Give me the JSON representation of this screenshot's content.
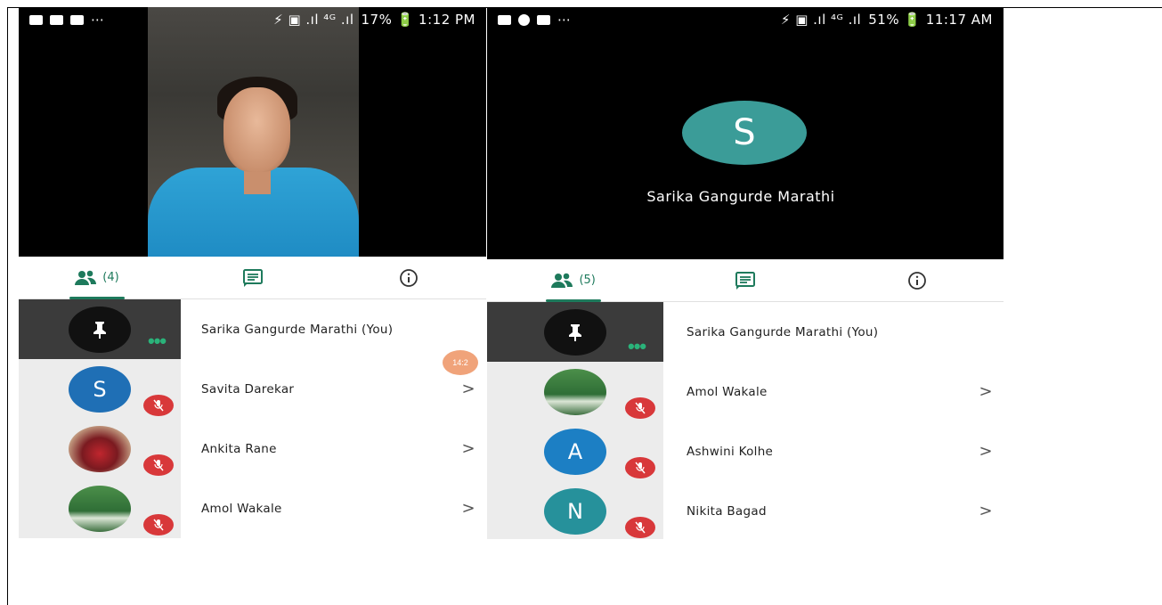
{
  "phone1": {
    "status": {
      "time_text": "17% 🔋 1:12 PM",
      "signal_text": "⚡ ▣ .ıl ⁴ᴳ .ıl",
      "left_icons": "⋯"
    },
    "tabs": {
      "people_count": "(4)"
    },
    "participants": [
      {
        "name": "Sarika Gangurde Marathi (You)",
        "avatar": "pin",
        "badge": "dots",
        "chevron": ""
      },
      {
        "name": "Savita Darekar",
        "avatar": "S",
        "badge": "muted",
        "chevron": ">"
      },
      {
        "name": "Ankita Rane",
        "avatar": "",
        "badge": "muted",
        "chevron": ">"
      },
      {
        "name": "Amol Wakale",
        "avatar": "",
        "badge": "muted",
        "chevron": ">"
      }
    ],
    "floating_bubble": "14:2"
  },
  "phone2": {
    "status": {
      "time_text": "51% 🔋 11:17 AM",
      "signal_text": "⚡ ▣ .ıl ⁴ᴳ .ıl",
      "left_icons": "⋯"
    },
    "caller": {
      "initial": "S",
      "name": "Sarika Gangurde Marathi"
    },
    "tabs": {
      "people_count": "(5)"
    },
    "participants": [
      {
        "name": "Sarika Gangurde Marathi (You)",
        "avatar": "pin",
        "badge": "dots",
        "chevron": ""
      },
      {
        "name": "Amol Wakale",
        "avatar": "",
        "badge": "muted",
        "chevron": ">"
      },
      {
        "name": "Ashwini Kolhe",
        "avatar": "A",
        "badge": "muted",
        "chevron": ">"
      },
      {
        "name": "Nikita Bagad",
        "avatar": "N",
        "badge": "muted",
        "chevron": ">"
      }
    ]
  },
  "colors": {
    "accent": "#1e7a5c",
    "muted_red": "#d8383a",
    "teal_avatar": "#3b9c98"
  },
  "icons": [
    "people-icon",
    "chat-icon",
    "info-icon",
    "pin-icon",
    "mic-off-icon",
    "more-dots-icon",
    "chevron-right-icon"
  ]
}
